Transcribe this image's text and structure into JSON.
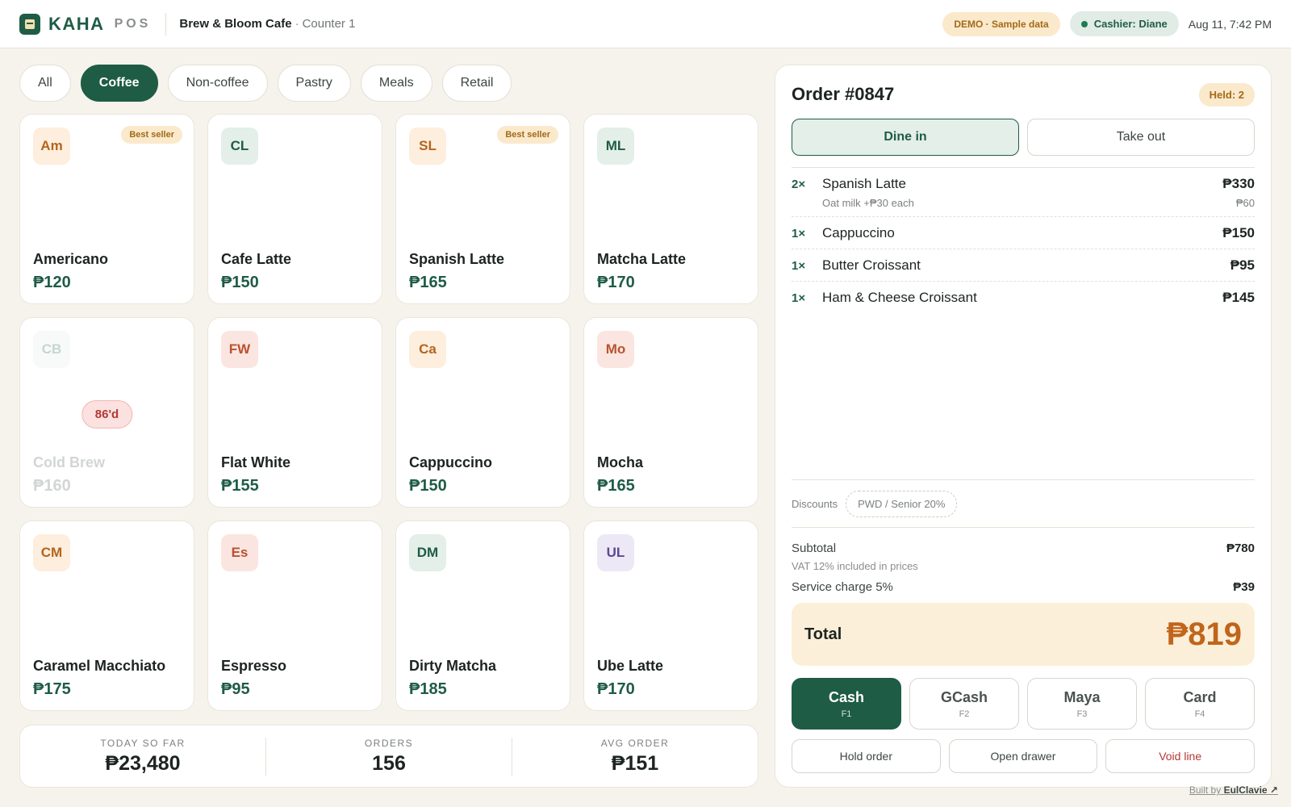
{
  "header": {
    "brand": "KAHA",
    "brand_sub": "POS",
    "shop_name": "Brew & Bloom Cafe",
    "separator": "·",
    "counter": "Counter 1",
    "demo_badge": "DEMO · Sample data",
    "cashier": "Cashier: Diane",
    "datetime": "Aug 11, 7:42 PM"
  },
  "categories": [
    "All",
    "Coffee",
    "Non-coffee",
    "Pastry",
    "Meals",
    "Retail"
  ],
  "active_category": "Coffee",
  "products": [
    {
      "abbr": "Am",
      "name": "Americano",
      "price": "₱120",
      "badge": "Best seller",
      "tone": "orange"
    },
    {
      "abbr": "CL",
      "name": "Cafe Latte",
      "price": "₱150",
      "tone": "green"
    },
    {
      "abbr": "SL",
      "name": "Spanish Latte",
      "price": "₱165",
      "badge": "Best seller",
      "tone": "orange"
    },
    {
      "abbr": "ML",
      "name": "Matcha Latte",
      "price": "₱170",
      "tone": "green"
    },
    {
      "abbr": "CB",
      "name": "Cold Brew",
      "price": "₱160",
      "status": "86'd",
      "tone": "green"
    },
    {
      "abbr": "FW",
      "name": "Flat White",
      "price": "₱155",
      "tone": "red"
    },
    {
      "abbr": "Ca",
      "name": "Cappuccino",
      "price": "₱150",
      "tone": "orange"
    },
    {
      "abbr": "Mo",
      "name": "Mocha",
      "price": "₱165",
      "tone": "red"
    },
    {
      "abbr": "CM",
      "name": "Caramel Macchiato",
      "price": "₱175",
      "tone": "orange"
    },
    {
      "abbr": "Es",
      "name": "Espresso",
      "price": "₱95",
      "tone": "red"
    },
    {
      "abbr": "DM",
      "name": "Dirty Matcha",
      "price": "₱185",
      "tone": "green"
    },
    {
      "abbr": "UL",
      "name": "Ube Latte",
      "price": "₱170",
      "tone": "purple"
    }
  ],
  "stats": [
    {
      "label": "TODAY SO FAR",
      "value": "₱23,480"
    },
    {
      "label": "ORDERS",
      "value": "156"
    },
    {
      "label": "AVG ORDER",
      "value": "₱151"
    }
  ],
  "order": {
    "title": "Order #0847",
    "held": "Held: 2",
    "modes": [
      "Dine in",
      "Take out"
    ],
    "active_mode": "Dine in",
    "lines": [
      {
        "qty": "2×",
        "name": "Spanish Latte",
        "modifier": "Oat milk +₱30 each",
        "price": "₱330",
        "sub": "₱60"
      },
      {
        "qty": "1×",
        "name": "Cappuccino",
        "price": "₱150"
      },
      {
        "qty": "1×",
        "name": "Butter Croissant",
        "price": "₱95"
      },
      {
        "qty": "1×",
        "name": "Ham & Cheese Croissant",
        "price": "₱145"
      }
    ],
    "discounts_label": "Discounts",
    "discount_option": "PWD / Senior 20%",
    "subtotal_label": "Subtotal",
    "subtotal": "₱780",
    "vat_note": "VAT 12% included in prices",
    "service_label": "Service charge 5%",
    "service": "₱39",
    "total_label": "Total",
    "total": "₱819",
    "payments": [
      {
        "name": "Cash",
        "key": "F1"
      },
      {
        "name": "GCash",
        "key": "F2"
      },
      {
        "name": "Maya",
        "key": "F3"
      },
      {
        "name": "Card",
        "key": "F4"
      }
    ],
    "active_payment": "Cash",
    "actions": [
      "Hold order",
      "Open drawer",
      "Void line"
    ]
  },
  "footer": {
    "built_by": "Built by",
    "author": "EulClavie ↗"
  },
  "colors": {
    "brand": "#1f5c45",
    "accent": "#c0651b",
    "background": "#f6f3ec",
    "danger": "#b03a36"
  }
}
